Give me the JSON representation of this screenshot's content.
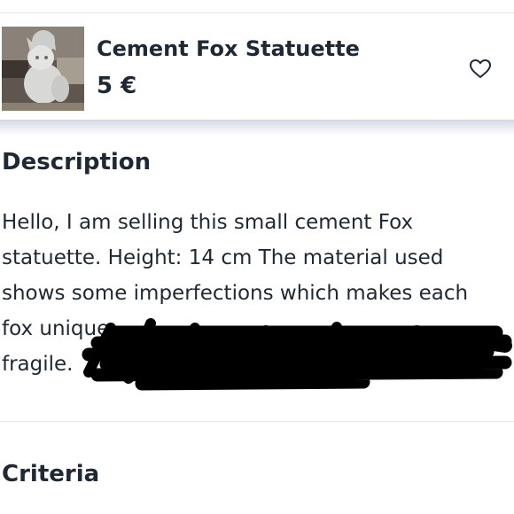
{
  "product": {
    "title": "Cement Fox Statuette",
    "price": "5 €",
    "thumbnail_icon": "fox-statuette-photo",
    "favorite_icon": "heart-icon"
  },
  "description": {
    "title": "Description",
    "lines": [
      "Hello, I am selling this small cement Fox",
      "statuette. Height: 14 cm The material used",
      "shows some imperfections which makes each",
      "fox unique.",
      "fragile."
    ]
  },
  "criteria": {
    "title": "Criteria"
  },
  "colors": {
    "text": "#1f2933",
    "divider": "#e5e7eb",
    "redaction": "#000000"
  }
}
